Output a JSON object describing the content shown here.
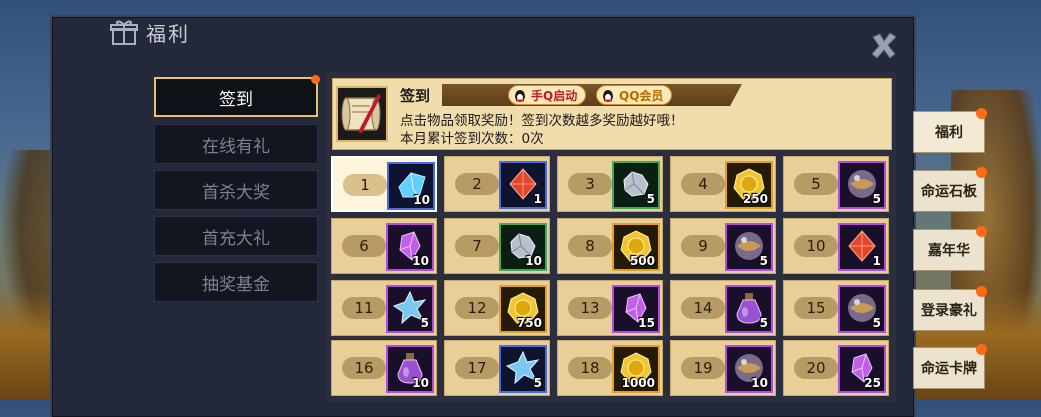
{
  "window": {
    "title": "福利",
    "title_icon": "gift-icon",
    "close_icon": "close-icon"
  },
  "left_tabs": [
    {
      "label": "签到",
      "active": true,
      "has_dot": true
    },
    {
      "label": "在线有礼",
      "active": false
    },
    {
      "label": "首杀大奖",
      "active": false
    },
    {
      "label": "首充大礼",
      "active": false
    },
    {
      "label": "抽奖基金",
      "active": false
    }
  ],
  "signin": {
    "title": "签到",
    "icon": "scroll-quill-icon",
    "badges": [
      {
        "label": "手Q启动",
        "icon": "qq-penguin-icon"
      },
      {
        "label": "QQ会员",
        "icon": "qq-penguin-icon"
      }
    ],
    "description": "点击物品领取奖励！签到次数越多奖励越好哦！",
    "count_text": "本月累计签到次数：0次"
  },
  "rewards": [
    {
      "day": "1",
      "item": "blue-crystal",
      "rarity": "blue",
      "qty": "10",
      "today": true
    },
    {
      "day": "2",
      "item": "red-gem",
      "rarity": "blue",
      "qty": "1"
    },
    {
      "day": "3",
      "item": "silver-ore",
      "rarity": "green",
      "qty": "5"
    },
    {
      "day": "4",
      "item": "gold-coin",
      "rarity": "orange",
      "qty": "250"
    },
    {
      "day": "5",
      "item": "orb",
      "rarity": "purple",
      "qty": "5"
    },
    {
      "day": "6",
      "item": "purple-crystal",
      "rarity": "purple",
      "qty": "10"
    },
    {
      "day": "7",
      "item": "silver-ore",
      "rarity": "green",
      "qty": "10"
    },
    {
      "day": "8",
      "item": "gold-coin",
      "rarity": "orange",
      "qty": "500"
    },
    {
      "day": "9",
      "item": "orb",
      "rarity": "purple",
      "qty": "5"
    },
    {
      "day": "10",
      "item": "red-gem",
      "rarity": "purple",
      "qty": "1"
    },
    {
      "day": "11",
      "item": "spiky-crystal",
      "rarity": "purple",
      "qty": "5"
    },
    {
      "day": "12",
      "item": "gold-coin",
      "rarity": "orange",
      "qty": "750"
    },
    {
      "day": "13",
      "item": "purple-crystal",
      "rarity": "purple",
      "qty": "15"
    },
    {
      "day": "14",
      "item": "potion",
      "rarity": "purple",
      "qty": "5"
    },
    {
      "day": "15",
      "item": "orb",
      "rarity": "purple",
      "qty": "5"
    },
    {
      "day": "16",
      "item": "potion",
      "rarity": "purple",
      "qty": "10"
    },
    {
      "day": "17",
      "item": "spiky-crystal",
      "rarity": "blue",
      "qty": "5"
    },
    {
      "day": "18",
      "item": "gold-coin",
      "rarity": "orange",
      "qty": "1000"
    },
    {
      "day": "19",
      "item": "orb",
      "rarity": "purple",
      "qty": "10"
    },
    {
      "day": "20",
      "item": "purple-crystal",
      "rarity": "purple",
      "qty": "25"
    }
  ],
  "side_tabs": [
    {
      "label": "福利",
      "has_dot": true,
      "active": true
    },
    {
      "label": "命运石板",
      "has_dot": true
    },
    {
      "label": "嘉年华",
      "has_dot": true
    },
    {
      "label": "登录豪礼",
      "has_dot": true
    },
    {
      "label": "命运卡牌",
      "has_dot": true
    }
  ],
  "colors": {
    "accent_gold": "#e7c070",
    "panel_bg": "#23283a",
    "cell_bg": "#e8cf9a",
    "notify_dot": "#ff6a14",
    "badge_red": "#c0192a"
  }
}
